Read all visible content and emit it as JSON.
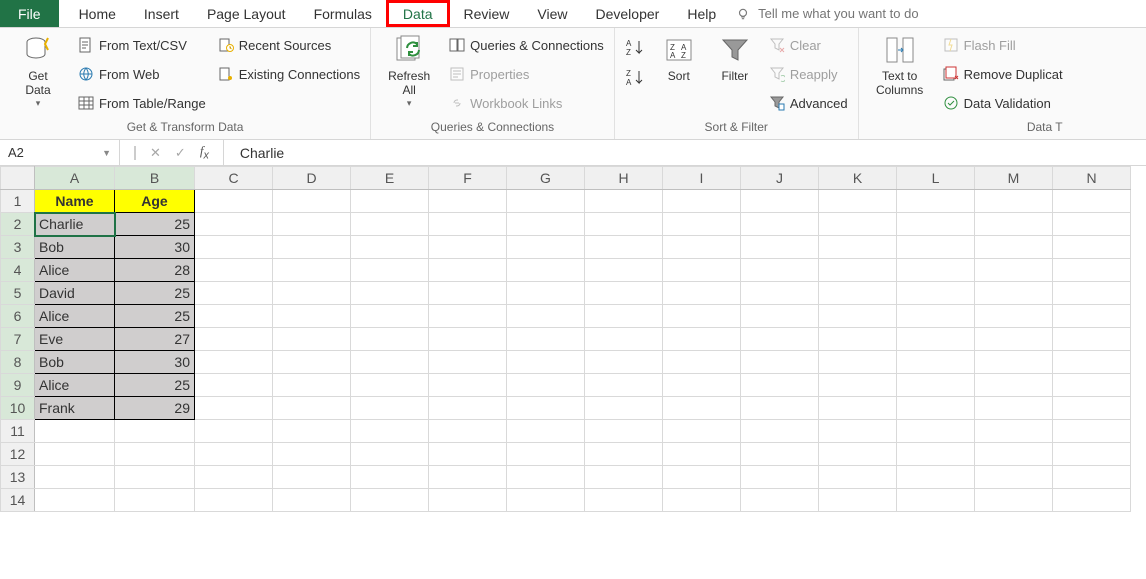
{
  "tabs": {
    "file": "File",
    "items": [
      "Home",
      "Insert",
      "Page Layout",
      "Formulas",
      "Data",
      "Review",
      "View",
      "Developer",
      "Help"
    ],
    "highlighted": "Data",
    "tellme_placeholder": "Tell me what you want to do"
  },
  "ribbon": {
    "group1": {
      "label": "Get & Transform Data",
      "get_data": "Get\nData",
      "from_text": "From Text/CSV",
      "from_web": "From Web",
      "from_table": "From Table/Range",
      "recent": "Recent Sources",
      "existing": "Existing Connections"
    },
    "group2": {
      "label": "Queries & Connections",
      "refresh": "Refresh\nAll",
      "queries": "Queries & Connections",
      "properties": "Properties",
      "links": "Workbook Links"
    },
    "group3": {
      "label": "Sort & Filter",
      "sort": "Sort",
      "filter": "Filter",
      "clear": "Clear",
      "reapply": "Reapply",
      "advanced": "Advanced"
    },
    "group4": {
      "label": "Data T",
      "text_to_cols": "Text to\nColumns",
      "flash_fill": "Flash Fill",
      "remove_dup": "Remove Duplicat",
      "validation": "Data Validation"
    }
  },
  "formula_bar": {
    "namebox": "A2",
    "value": "Charlie"
  },
  "sheet": {
    "columns": [
      "A",
      "B",
      "C",
      "D",
      "E",
      "F",
      "G",
      "H",
      "I",
      "J",
      "K",
      "L",
      "M",
      "N"
    ],
    "selected_cols": [
      "A",
      "B"
    ],
    "headers": {
      "A": "Name",
      "B": "Age"
    },
    "rows": [
      {
        "n": 2,
        "A": "Charlie",
        "B": 25
      },
      {
        "n": 3,
        "A": "Bob",
        "B": 30
      },
      {
        "n": 4,
        "A": "Alice",
        "B": 28
      },
      {
        "n": 5,
        "A": "David",
        "B": 25
      },
      {
        "n": 6,
        "A": "Alice",
        "B": 25
      },
      {
        "n": 7,
        "A": "Eve",
        "B": 27
      },
      {
        "n": 8,
        "A": "Bob",
        "B": 30
      },
      {
        "n": 9,
        "A": "Alice",
        "B": 25
      },
      {
        "n": 10,
        "A": "Frank",
        "B": 29
      }
    ],
    "blank_rows": [
      11,
      12,
      13,
      14
    ]
  }
}
